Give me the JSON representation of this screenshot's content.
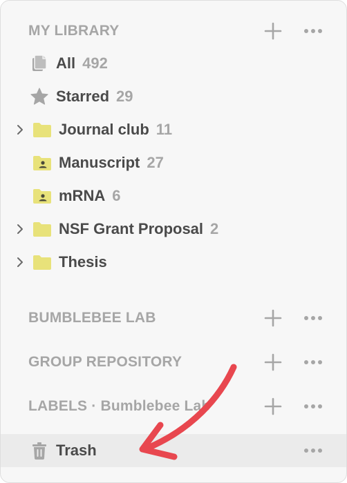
{
  "library": {
    "title": "MY LIBRARY",
    "items": [
      {
        "label": "All",
        "count": "492",
        "icon": "documents-icon"
      },
      {
        "label": "Starred",
        "count": "29",
        "icon": "star-icon"
      },
      {
        "label": "Journal club",
        "count": "11",
        "icon": "folder-icon",
        "expandable": true
      },
      {
        "label": "Manuscript",
        "count": "27",
        "icon": "shared-folder-icon"
      },
      {
        "label": "mRNA",
        "count": "6",
        "icon": "shared-folder-icon"
      },
      {
        "label": "NSF Grant Proposal",
        "count": "2",
        "icon": "folder-icon",
        "expandable": true
      },
      {
        "label": "Thesis",
        "count": "",
        "icon": "folder-icon",
        "expandable": true
      }
    ]
  },
  "sections": [
    {
      "title": "BUMBLEBEE LAB"
    },
    {
      "title": "GROUP REPOSITORY"
    },
    {
      "title": "LABELS · Bumblebee Lab"
    }
  ],
  "trash": {
    "label": "Trash",
    "icon": "trash-icon"
  },
  "colors": {
    "folder": "#e8e27a",
    "folder_dark": "#d6ce55",
    "icon_gray": "#a6a6a6",
    "text_dark": "#4a4a4a",
    "text_muted": "#a6a6a6",
    "arrow": "#e8474f"
  }
}
